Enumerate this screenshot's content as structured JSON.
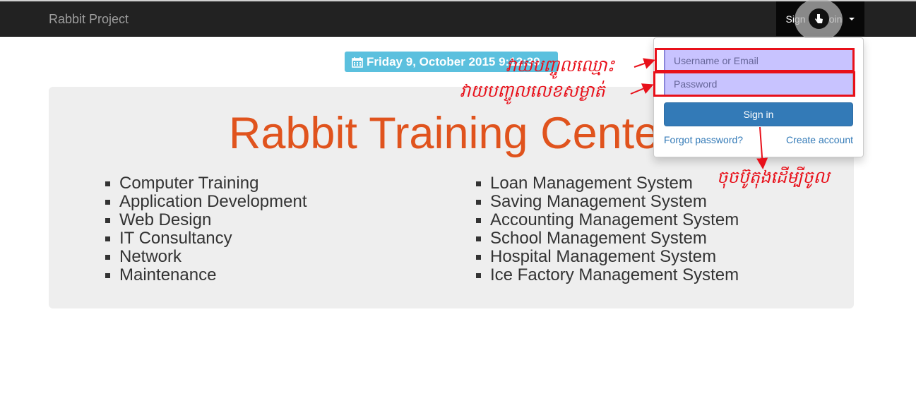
{
  "navbar": {
    "brand": "Rabbit Project",
    "signin_label": "Sign in | Join"
  },
  "date_label": "Friday 9, October 2015 9:12:39",
  "jumbotron": {
    "title": "Rabbit Training Center",
    "left_list": [
      "Computer Training",
      "Application Development",
      "Web Design",
      "IT Consultancy",
      "Network",
      "Maintenance"
    ],
    "right_list": [
      "Loan Management System",
      "Saving Management System",
      "Accounting Management System",
      "School Management System",
      "Hospital Management System",
      "Ice Factory Management System"
    ]
  },
  "login": {
    "username_placeholder": "Username or Email",
    "password_placeholder": "Password",
    "signin_button": "Sign in",
    "forgot_link": "Forgot password?",
    "create_link": "Create account"
  },
  "annotations": {
    "username_note": "វាយបញ្ចូលឈ្មោះ",
    "password_note": "វាយបញ្ចូលលេខសម្ងាត់",
    "button_note": "ចុចប៊ូតុងដើម្បីចូល"
  },
  "colors": {
    "navbar": "#222222",
    "title": "#e0531d",
    "date_badge": "#5bc0de",
    "primary": "#337ab7",
    "annotation": "#e8101a"
  },
  "icons": [
    "calendar-icon",
    "hand-cursor-icon",
    "caret-down-icon"
  ]
}
